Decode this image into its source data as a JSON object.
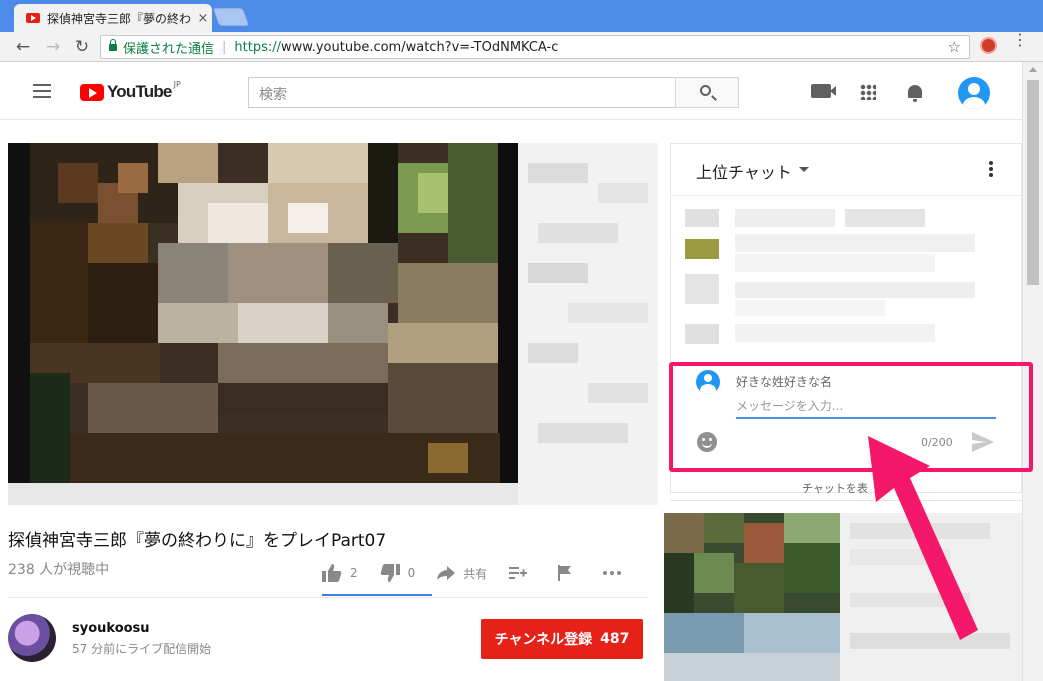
{
  "browser": {
    "tab_title": "探偵神宮寺三郎『夢の終わ",
    "tab_close": "×",
    "secure_label": "保護された通信",
    "url_scheme": "https://",
    "url_rest": "www.youtube.com/watch?v=-TOdNMKCA-c",
    "back": "←",
    "forward": "→",
    "reload": "↻",
    "star": "☆",
    "menu": "⋮"
  },
  "masthead": {
    "logo_text": "YouTube",
    "logo_region": "JP",
    "search_placeholder": "検索"
  },
  "video": {
    "title": "探偵神宮寺三郎『夢の終わりに』をプレイPart07",
    "viewers": "238 人が視聴中",
    "likes": "2",
    "dislikes": "0",
    "share": "共有"
  },
  "owner": {
    "name": "syoukoosu",
    "sub": "57 分前にライブ配信開始",
    "subscribe_label": "チャンネル登録",
    "subscriber_count": "487"
  },
  "chat": {
    "title": "上位チャット",
    "author_name": "好きな姓好きな名",
    "input_placeholder": "メッセージを入力...",
    "char_count": "0/200",
    "toggle_label": "チャットを表"
  },
  "colors": {
    "accent": "#3d7fe6",
    "subscribe": "#e62117",
    "highlight": "#f5186a"
  }
}
